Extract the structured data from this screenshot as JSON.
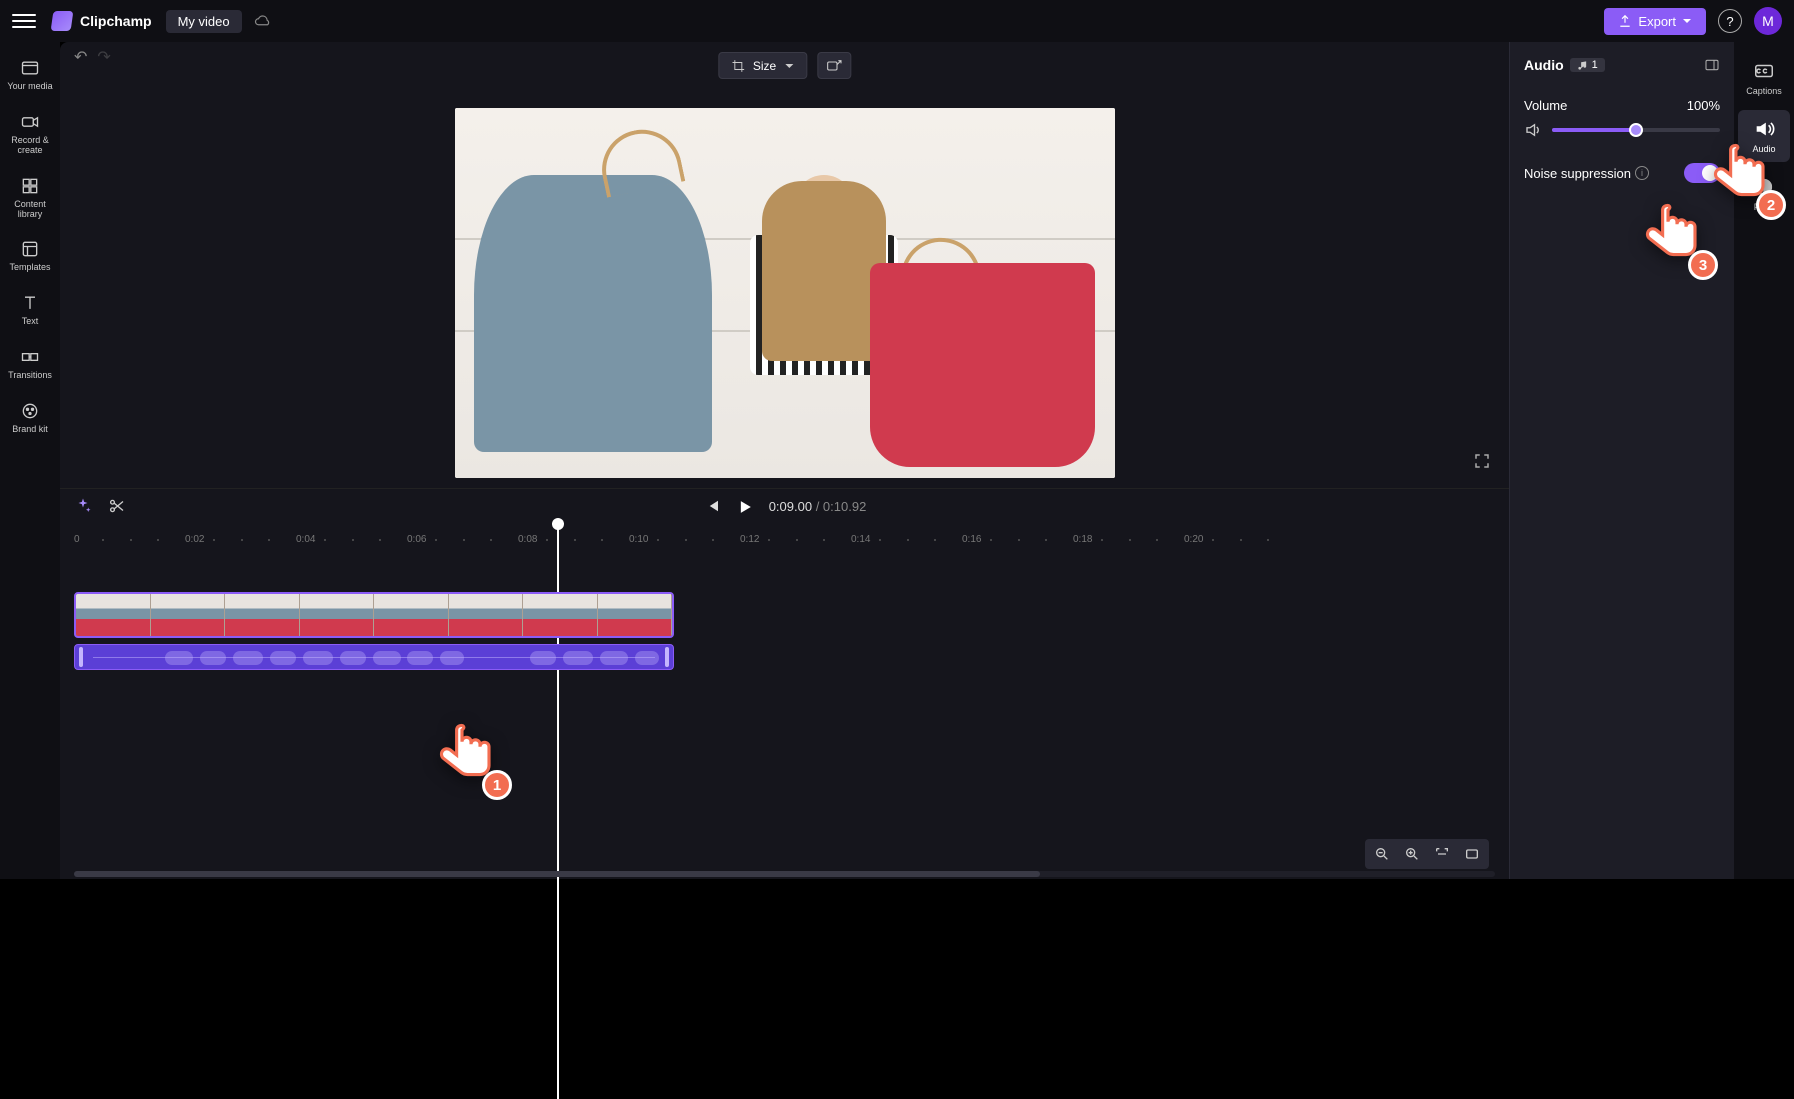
{
  "app": {
    "name": "Clipchamp",
    "project": "My video"
  },
  "topbar": {
    "export_label": "Export",
    "avatar_initial": "M"
  },
  "leftnav": [
    {
      "id": "your-media",
      "label": "Your media"
    },
    {
      "id": "record-create",
      "label": "Record & create"
    },
    {
      "id": "content-library",
      "label": "Content library"
    },
    {
      "id": "templates",
      "label": "Templates"
    },
    {
      "id": "text",
      "label": "Text"
    },
    {
      "id": "transitions",
      "label": "Transitions"
    },
    {
      "id": "brand-kit",
      "label": "Brand kit"
    }
  ],
  "preview": {
    "size_label": "Size"
  },
  "playback": {
    "current_time": "0:09.00",
    "sep": " / ",
    "duration": "0:10.92"
  },
  "ruler_labels": [
    "0",
    "0:02",
    "0:04",
    "0:06",
    "0:08",
    "0:10",
    "0:12",
    "0:14",
    "0:16",
    "0:18",
    "0:20"
  ],
  "right_panel": {
    "title": "Audio",
    "badge_count": "1",
    "volume_label": "Volume",
    "volume_value": "100%",
    "noise_label": "Noise suppression"
  },
  "toolstrip": [
    {
      "id": "captions",
      "label": "Captions"
    },
    {
      "id": "audio",
      "label": "Audio"
    },
    {
      "id": "fade",
      "label": "Fade"
    }
  ],
  "callouts": {
    "one": "1",
    "two": "2",
    "three": "3"
  }
}
